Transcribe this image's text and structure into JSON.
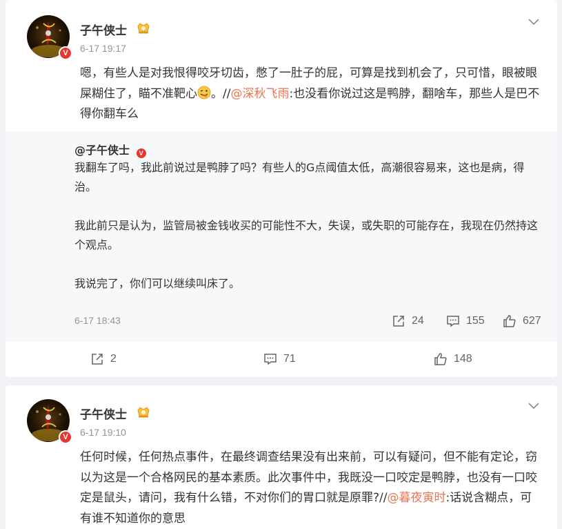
{
  "posts": [
    {
      "username": "子午侠士",
      "timestamp": "6-17 19:17",
      "text_part1": "嗯，有些人是对我恨得咬牙切齿，憋了一肚子的屁，可算是找到机会了，只可惜，眼被眼屎糊住了，瞄不准靶心",
      "text_part2": "。//",
      "mention": "@深秋飞雨",
      "text_part3": ":也没看你说过这是鸭脖，翻啥车，那些人是巴不得你翻车么",
      "repost": {
        "username": "@子午侠士",
        "paragraphs": [
          "我翻车了吗，我此前说过是鸭脖了吗？有些人的G点阈值太低，高潮很容易来，这也是病，得治。",
          "我此前只是认为，监管局被金钱收买的可能性不大，失误，或失职的可能存在，我现在仍然持这个观点。",
          "我说完了，你们可以继续叫床了。"
        ],
        "timestamp": "6-17 18:43",
        "reposts": "24",
        "comments": "155",
        "likes": "627"
      },
      "reposts": "2",
      "comments": "71",
      "likes": "148"
    },
    {
      "username": "子午侠士",
      "timestamp": "6-17 19:10",
      "text_part1": "任何时候，任何热点事件，在最终调查结果没有出来前，可以有疑问，但不能有定论，窃以为这是一个合格网民的基本素质。此次事件中，我既没一口咬定是鸭脖，也没有一口咬定是鼠头，请问，我有什么错，不对你们的胃口就是原罪?//",
      "mention": "@暮夜寅时",
      "text_part2": ":话说含糊点，可有谁不知道你的意思"
    }
  ],
  "icons": {
    "verified": "V",
    "level": "level-badge-icon",
    "repost": "repost-icon",
    "comment": "comment-icon",
    "like": "like-icon",
    "more": "chevron-down-icon",
    "emoji": "wink-tongue-emoji"
  },
  "colors": {
    "mention": "#eb7350",
    "verified_badge": "#e8362f",
    "background": "#f1f2f5",
    "repost_bg": "#f7f8fa"
  }
}
